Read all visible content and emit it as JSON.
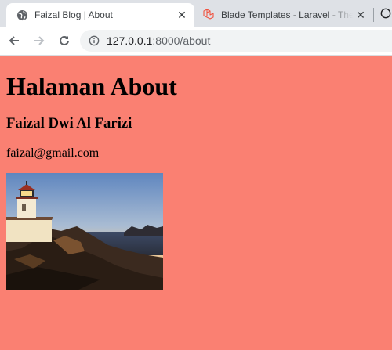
{
  "browser": {
    "tabs": [
      {
        "title": "Faizal Blog | About",
        "active": true,
        "icon": "globe-icon"
      },
      {
        "title": "Blade Templates - Laravel - The PHP Framework",
        "active": false,
        "icon": "laravel-icon"
      }
    ],
    "url": {
      "host": "127.0.0.1",
      "rest": ":8000/about"
    }
  },
  "page": {
    "heading": "Halaman About",
    "name": "Faizal Dwi Al Farizi",
    "email": "faizal@gmail.com",
    "image_alt": "lighthouse-photo",
    "background": "#fa8072"
  }
}
